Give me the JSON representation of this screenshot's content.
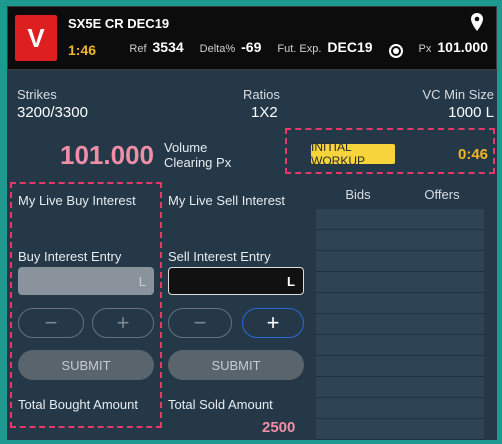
{
  "header": {
    "badge": "V",
    "instrument": "SX5E  CR DEC19",
    "timer": "1:46",
    "ref_label": "Ref",
    "ref_value": "3534",
    "delta_label": "Delta%",
    "delta_value": "-69",
    "fut_label": "Fut. Exp.",
    "fut_value": "DEC19",
    "px_label": "Px",
    "px_value": "101.000",
    "icons": [
      "location-pin-icon",
      "radio-selected-icon"
    ]
  },
  "info": {
    "strikes_label": "Strikes",
    "strikes_value": "3200/3300",
    "ratios_label": "Ratios",
    "ratios_value": "1X2",
    "vc_label": "VC Min Size",
    "vc_value": "1000 L"
  },
  "clearing": {
    "price": "101.000",
    "label_line1": "Volume",
    "label_line2": "Clearing Px"
  },
  "workup": {
    "status": "INITIAL WORKUP",
    "countdown": "0:46"
  },
  "buy": {
    "title": "My Live Buy Interest",
    "entry_label": "Buy Interest Entry",
    "entry_unit": "L",
    "minus": "−",
    "plus": "+",
    "submit": "SUBMIT",
    "total_label": "Total Bought Amount"
  },
  "sell": {
    "title": "My Live Sell Interest",
    "entry_label": "Sell Interest Entry",
    "entry_unit": "L",
    "minus": "−",
    "plus": "+",
    "submit": "SUBMIT",
    "total_label": "Total Sold Amount",
    "total_value": "2500"
  },
  "book": {
    "bids_label": "Bids",
    "offers_label": "Offers"
  },
  "colors": {
    "accent_teal": "#1d9a90",
    "badge_red": "#dd1f1f",
    "timer_orange": "#f0b623",
    "highlight_pink": "#ef8ea6",
    "workup_yellow": "#f7d43c",
    "dash_pink": "#e8386a"
  }
}
